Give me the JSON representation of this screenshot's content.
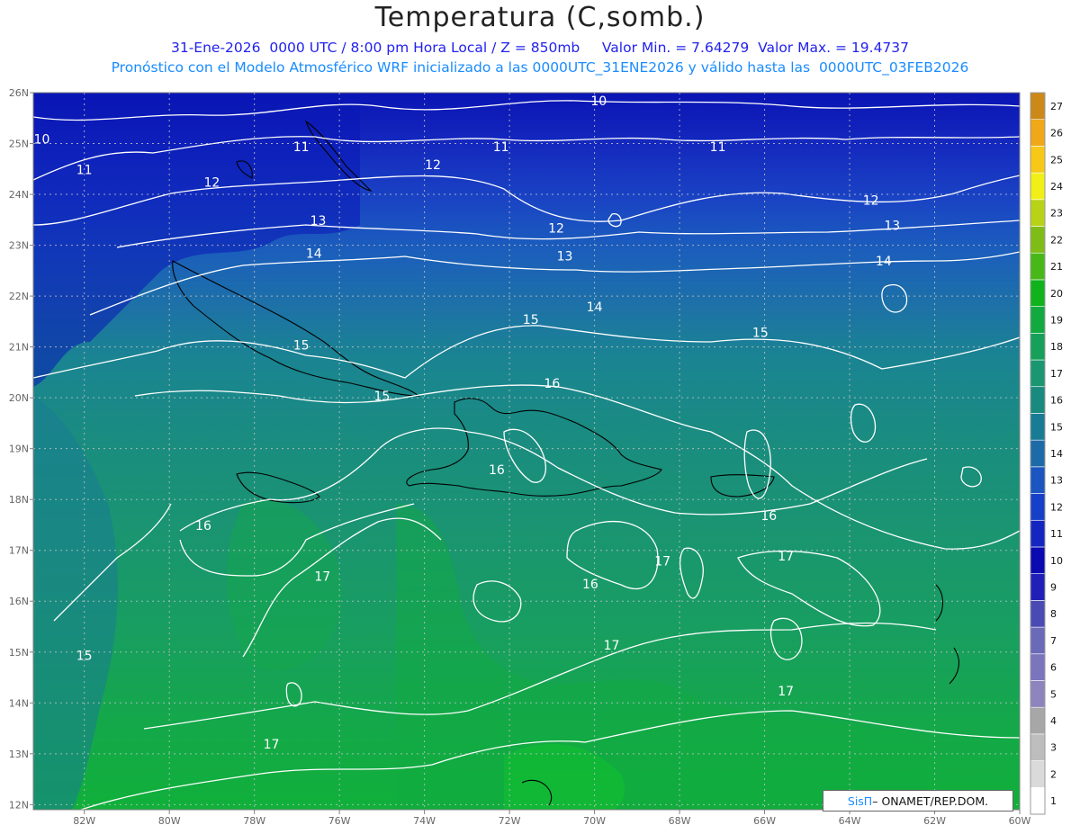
{
  "title": "Temperatura (C,somb.)",
  "subtitle_1": "31-Ene-2026  0000 UTC / 8:00 pm Hora Local / Z = 850mb     Valor Min. = 7.64279  Valor Max. = 19.4737",
  "subtitle_2": "Pronóstico con el Modelo Atmosférico WRF inicializado a las 0000UTC_31ENE2026 y válido hasta las  0000UTC_03FEB2026",
  "credit": {
    "brand": "SisΠ",
    "text": "– ONAMET/REP.DOM."
  },
  "map": {
    "lon_labels": [
      "82W",
      "80W",
      "78W",
      "76W",
      "74W",
      "72W",
      "70W",
      "68W",
      "66W",
      "64W",
      "62W",
      "60W"
    ],
    "lat_labels": [
      "26N",
      "25N",
      "24N",
      "23N",
      "22N",
      "21N",
      "20N",
      "19N",
      "18N",
      "17N",
      "16N",
      "15N",
      "14N",
      "13N",
      "12N"
    ],
    "contour_labels": [
      {
        "text": "10",
        "lon": -83.0,
        "lat": 25.0
      },
      {
        "text": "10",
        "lon": -69.9,
        "lat": 25.75
      },
      {
        "text": "11",
        "lon": -82.0,
        "lat": 24.4
      },
      {
        "text": "11",
        "lon": -76.9,
        "lat": 24.85
      },
      {
        "text": "11",
        "lon": -72.2,
        "lat": 24.85
      },
      {
        "text": "11",
        "lon": -67.1,
        "lat": 24.85
      },
      {
        "text": "12",
        "lon": -79.0,
        "lat": 24.15
      },
      {
        "text": "12",
        "lon": -73.8,
        "lat": 24.5
      },
      {
        "text": "12",
        "lon": -70.9,
        "lat": 23.25
      },
      {
        "text": "12",
        "lon": -63.5,
        "lat": 23.8
      },
      {
        "text": "13",
        "lon": -76.5,
        "lat": 23.4
      },
      {
        "text": "13",
        "lon": -70.7,
        "lat": 22.7
      },
      {
        "text": "13",
        "lon": -63.0,
        "lat": 23.3
      },
      {
        "text": "14",
        "lon": -76.6,
        "lat": 22.75
      },
      {
        "text": "14",
        "lon": -70.0,
        "lat": 21.7
      },
      {
        "text": "14",
        "lon": -63.2,
        "lat": 22.6
      },
      {
        "text": "15",
        "lon": -76.9,
        "lat": 20.95
      },
      {
        "text": "15",
        "lon": -75.0,
        "lat": 19.95
      },
      {
        "text": "15",
        "lon": -71.5,
        "lat": 21.45
      },
      {
        "text": "15",
        "lon": -66.1,
        "lat": 21.2
      },
      {
        "text": "15",
        "lon": -82.0,
        "lat": 14.85
      },
      {
        "text": "16",
        "lon": -71.0,
        "lat": 20.2
      },
      {
        "text": "16",
        "lon": -72.3,
        "lat": 18.5
      },
      {
        "text": "16",
        "lon": -79.2,
        "lat": 17.4
      },
      {
        "text": "16",
        "lon": -70.1,
        "lat": 16.25
      },
      {
        "text": "16",
        "lon": -65.9,
        "lat": 17.6
      },
      {
        "text": "17",
        "lon": -76.4,
        "lat": 16.4
      },
      {
        "text": "17",
        "lon": -68.4,
        "lat": 16.7
      },
      {
        "text": "17",
        "lon": -69.6,
        "lat": 15.05
      },
      {
        "text": "17",
        "lon": -65.5,
        "lat": 16.8
      },
      {
        "text": "17",
        "lon": -65.5,
        "lat": 14.15
      },
      {
        "text": "17",
        "lon": -77.6,
        "lat": 13.1
      }
    ]
  },
  "colorbar": {
    "levels": [
      1,
      2,
      3,
      4,
      5,
      6,
      7,
      8,
      9,
      10,
      11,
      12,
      13,
      14,
      15,
      16,
      17,
      18,
      19,
      20,
      21,
      22,
      23,
      24,
      25,
      26,
      27
    ],
    "colors": [
      "#ffffff",
      "#dadada",
      "#bdbdbd",
      "#a7a7a7",
      "#8e84bd",
      "#7a75bd",
      "#6a6ab8",
      "#4a4ab4",
      "#2020b8",
      "#0a0ab0",
      "#1526c0",
      "#1740c8",
      "#1a55c0",
      "#1d6aa8",
      "#1a7c94",
      "#1a8a7e",
      "#1a9670",
      "#16a05a",
      "#12aa40",
      "#10b31c",
      "#48b818",
      "#80bc18",
      "#b8d218",
      "#f0f018",
      "#f8c818",
      "#f0a818",
      "#cc8818"
    ]
  }
}
